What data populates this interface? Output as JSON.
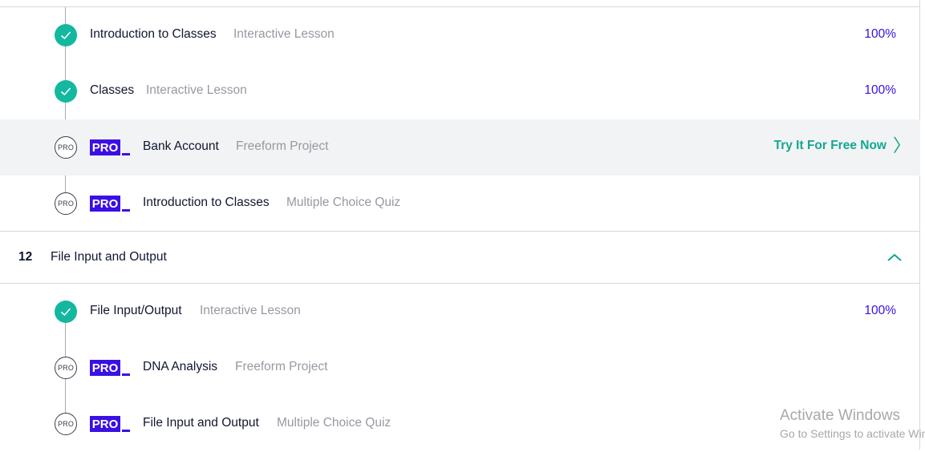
{
  "lessons_top": [
    {
      "title": "Introduction to Classes",
      "type": "Interactive Lesson",
      "status": "complete",
      "progress": "100%"
    },
    {
      "title": "Classes",
      "type": "Interactive Lesson",
      "status": "complete",
      "progress": "100%"
    },
    {
      "title": "Bank Account",
      "type": "Freeform Project",
      "status": "pro",
      "badge": "PRO",
      "circle": "PRO",
      "cta": "Try It For Free Now",
      "highlighted": true
    },
    {
      "title": "Introduction to Classes",
      "type": "Multiple Choice Quiz",
      "status": "pro",
      "badge": "PRO",
      "circle": "PRO"
    }
  ],
  "section": {
    "number": "12",
    "title": "File Input and Output",
    "expanded": true,
    "toggle_icon": "chevron-up-icon"
  },
  "lessons_bottom": [
    {
      "title": "File Input/Output",
      "type": "Interactive Lesson",
      "status": "complete",
      "progress": "100%"
    },
    {
      "title": "DNA Analysis",
      "type": "Freeform Project",
      "status": "pro",
      "badge": "PRO",
      "circle": "PRO"
    },
    {
      "title": "File Input and Output",
      "type": "Multiple Choice Quiz",
      "status": "pro",
      "badge": "PRO",
      "circle": "PRO"
    }
  ],
  "watermark": {
    "line1": "Activate Windows",
    "line2": "Go to Settings to activate Windows."
  },
  "colors": {
    "accent": "#3a10e5",
    "success": "#13b89f",
    "cta": "#13a88f",
    "highlight_bg": "#f2f3f5"
  }
}
